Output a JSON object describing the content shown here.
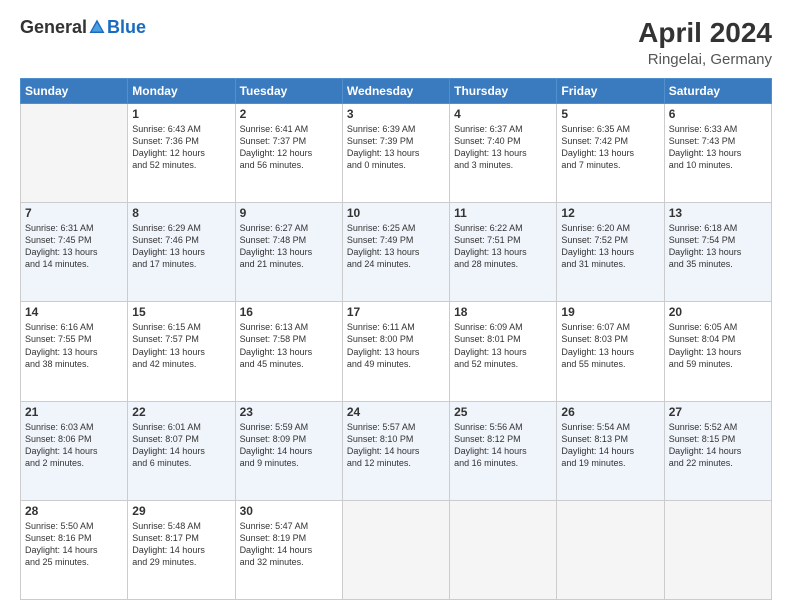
{
  "header": {
    "logo_general": "General",
    "logo_blue": "Blue",
    "title": "April 2024",
    "subtitle": "Ringelai, Germany"
  },
  "days_of_week": [
    "Sunday",
    "Monday",
    "Tuesday",
    "Wednesday",
    "Thursday",
    "Friday",
    "Saturday"
  ],
  "weeks": [
    [
      {
        "day": "",
        "info": ""
      },
      {
        "day": "1",
        "info": "Sunrise: 6:43 AM\nSunset: 7:36 PM\nDaylight: 12 hours\nand 52 minutes."
      },
      {
        "day": "2",
        "info": "Sunrise: 6:41 AM\nSunset: 7:37 PM\nDaylight: 12 hours\nand 56 minutes."
      },
      {
        "day": "3",
        "info": "Sunrise: 6:39 AM\nSunset: 7:39 PM\nDaylight: 13 hours\nand 0 minutes."
      },
      {
        "day": "4",
        "info": "Sunrise: 6:37 AM\nSunset: 7:40 PM\nDaylight: 13 hours\nand 3 minutes."
      },
      {
        "day": "5",
        "info": "Sunrise: 6:35 AM\nSunset: 7:42 PM\nDaylight: 13 hours\nand 7 minutes."
      },
      {
        "day": "6",
        "info": "Sunrise: 6:33 AM\nSunset: 7:43 PM\nDaylight: 13 hours\nand 10 minutes."
      }
    ],
    [
      {
        "day": "7",
        "info": "Sunrise: 6:31 AM\nSunset: 7:45 PM\nDaylight: 13 hours\nand 14 minutes."
      },
      {
        "day": "8",
        "info": "Sunrise: 6:29 AM\nSunset: 7:46 PM\nDaylight: 13 hours\nand 17 minutes."
      },
      {
        "day": "9",
        "info": "Sunrise: 6:27 AM\nSunset: 7:48 PM\nDaylight: 13 hours\nand 21 minutes."
      },
      {
        "day": "10",
        "info": "Sunrise: 6:25 AM\nSunset: 7:49 PM\nDaylight: 13 hours\nand 24 minutes."
      },
      {
        "day": "11",
        "info": "Sunrise: 6:22 AM\nSunset: 7:51 PM\nDaylight: 13 hours\nand 28 minutes."
      },
      {
        "day": "12",
        "info": "Sunrise: 6:20 AM\nSunset: 7:52 PM\nDaylight: 13 hours\nand 31 minutes."
      },
      {
        "day": "13",
        "info": "Sunrise: 6:18 AM\nSunset: 7:54 PM\nDaylight: 13 hours\nand 35 minutes."
      }
    ],
    [
      {
        "day": "14",
        "info": "Sunrise: 6:16 AM\nSunset: 7:55 PM\nDaylight: 13 hours\nand 38 minutes."
      },
      {
        "day": "15",
        "info": "Sunrise: 6:15 AM\nSunset: 7:57 PM\nDaylight: 13 hours\nand 42 minutes."
      },
      {
        "day": "16",
        "info": "Sunrise: 6:13 AM\nSunset: 7:58 PM\nDaylight: 13 hours\nand 45 minutes."
      },
      {
        "day": "17",
        "info": "Sunrise: 6:11 AM\nSunset: 8:00 PM\nDaylight: 13 hours\nand 49 minutes."
      },
      {
        "day": "18",
        "info": "Sunrise: 6:09 AM\nSunset: 8:01 PM\nDaylight: 13 hours\nand 52 minutes."
      },
      {
        "day": "19",
        "info": "Sunrise: 6:07 AM\nSunset: 8:03 PM\nDaylight: 13 hours\nand 55 minutes."
      },
      {
        "day": "20",
        "info": "Sunrise: 6:05 AM\nSunset: 8:04 PM\nDaylight: 13 hours\nand 59 minutes."
      }
    ],
    [
      {
        "day": "21",
        "info": "Sunrise: 6:03 AM\nSunset: 8:06 PM\nDaylight: 14 hours\nand 2 minutes."
      },
      {
        "day": "22",
        "info": "Sunrise: 6:01 AM\nSunset: 8:07 PM\nDaylight: 14 hours\nand 6 minutes."
      },
      {
        "day": "23",
        "info": "Sunrise: 5:59 AM\nSunset: 8:09 PM\nDaylight: 14 hours\nand 9 minutes."
      },
      {
        "day": "24",
        "info": "Sunrise: 5:57 AM\nSunset: 8:10 PM\nDaylight: 14 hours\nand 12 minutes."
      },
      {
        "day": "25",
        "info": "Sunrise: 5:56 AM\nSunset: 8:12 PM\nDaylight: 14 hours\nand 16 minutes."
      },
      {
        "day": "26",
        "info": "Sunrise: 5:54 AM\nSunset: 8:13 PM\nDaylight: 14 hours\nand 19 minutes."
      },
      {
        "day": "27",
        "info": "Sunrise: 5:52 AM\nSunset: 8:15 PM\nDaylight: 14 hours\nand 22 minutes."
      }
    ],
    [
      {
        "day": "28",
        "info": "Sunrise: 5:50 AM\nSunset: 8:16 PM\nDaylight: 14 hours\nand 25 minutes."
      },
      {
        "day": "29",
        "info": "Sunrise: 5:48 AM\nSunset: 8:17 PM\nDaylight: 14 hours\nand 29 minutes."
      },
      {
        "day": "30",
        "info": "Sunrise: 5:47 AM\nSunset: 8:19 PM\nDaylight: 14 hours\nand 32 minutes."
      },
      {
        "day": "",
        "info": ""
      },
      {
        "day": "",
        "info": ""
      },
      {
        "day": "",
        "info": ""
      },
      {
        "day": "",
        "info": ""
      }
    ]
  ]
}
